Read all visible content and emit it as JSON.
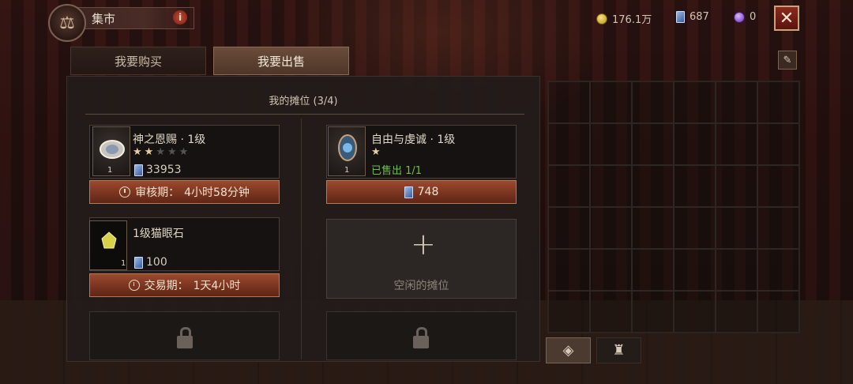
{
  "header": {
    "title": "集市",
    "info_label": "i",
    "gold": "176.1万",
    "cards": "687",
    "orbs": "0",
    "close_label": "✕"
  },
  "tabs": [
    {
      "label": "我要购买",
      "active": false
    },
    {
      "label": "我要出售",
      "active": true
    }
  ],
  "panel": {
    "title": "我的摊位 (3/4)"
  },
  "slots": [
    {
      "name": "神之恩赐 · 1级",
      "stars_on": 2,
      "stars_total": 5,
      "quantity": "1",
      "price": "33953",
      "status_label": "审核期：",
      "status_value": "4小时58分钟"
    },
    {
      "name": "自由与虔诚 · 1级",
      "stars_on": 1,
      "stars_total": 1,
      "quantity": "1",
      "sold_text": "已售出  1/1",
      "bar_price": "748"
    },
    {
      "name": "1级猫眼石",
      "quantity": "1",
      "price": "100",
      "status_label": "交易期：",
      "status_value": "1天4小时"
    },
    {
      "empty_label": "空闲的摊位"
    }
  ],
  "icons": {
    "emblem": "scales-icon",
    "gold": "gold-coin-icon",
    "card": "card-icon",
    "orb": "orb-icon",
    "lock": "lock-icon",
    "clock": "clock-icon"
  },
  "colors": {
    "accent_bar": "#7a3420",
    "sold_green": "#6ec04a",
    "close_red": "#8a2a1e"
  }
}
